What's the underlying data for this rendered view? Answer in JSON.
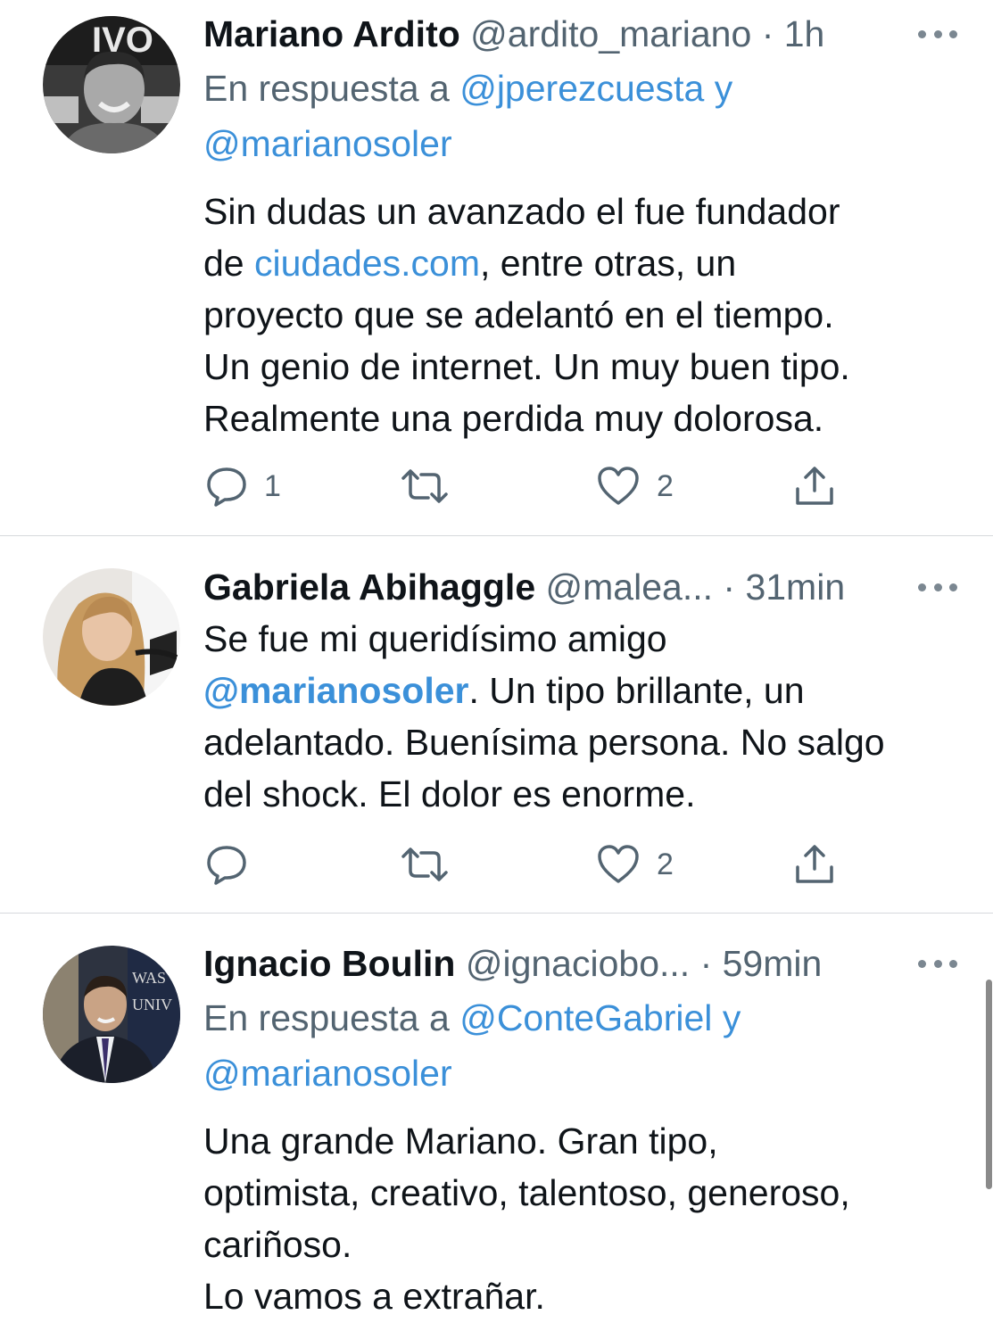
{
  "tweets": [
    {
      "author": "Mariano Ardito",
      "handle": "@ardito_mariano",
      "time": "· 1h",
      "reply_prefix": "En respuesta a",
      "reply_users": [
        "@jperezcuesta",
        "@marianosoler"
      ],
      "reply_joiner": "y",
      "body": {
        "line1": "Sin dudas un avanzado el fue fundador",
        "line2_pre": "de ",
        "line2_link": "ciudades.com",
        "line2_post": ", entre otras, un",
        "line3": "proyecto que se adelantó en el tiempo.",
        "line4": "Un genio de internet. Un muy buen tipo.",
        "line5": "Realmente una perdida muy dolorosa."
      },
      "counts": {
        "replies": "1",
        "retweets": "",
        "likes": "2"
      }
    },
    {
      "author": "Gabriela Abihaggle",
      "handle": "@malea...",
      "time": "· 31min",
      "body": {
        "line1": "Se fue mi queridísimo amigo",
        "line2_mention": "@marianosoler",
        "line2_post": ". Un tipo brillante, un",
        "line3": "adelantado. Buenísima persona. No salgo",
        "line4": "del shock. El dolor es enorme."
      },
      "counts": {
        "replies": "",
        "retweets": "",
        "likes": "2"
      }
    },
    {
      "author": "Ignacio Boulin",
      "handle": "@ignaciobo...",
      "time": "· 59min",
      "reply_prefix": "En respuesta a",
      "reply_users": [
        "@ConteGabriel",
        "@marianosoler"
      ],
      "reply_joiner": "y",
      "body": {
        "line1": "Una grande Mariano. Gran tipo,",
        "line2": "optimista, creativo, talentoso, generoso,",
        "line3": "cariñoso.",
        "line4": "Lo vamos a extrañar."
      }
    }
  ],
  "icons": {
    "reply": "speech-bubble-icon",
    "retweet": "retweet-arrows-icon",
    "like": "heart-outline-icon",
    "share": "share-upload-icon",
    "more": "ellipsis-icon"
  },
  "colors": {
    "link": "#3b90d9",
    "meta": "#536471",
    "text": "#0f1419",
    "divider": "#d6d9dc"
  }
}
